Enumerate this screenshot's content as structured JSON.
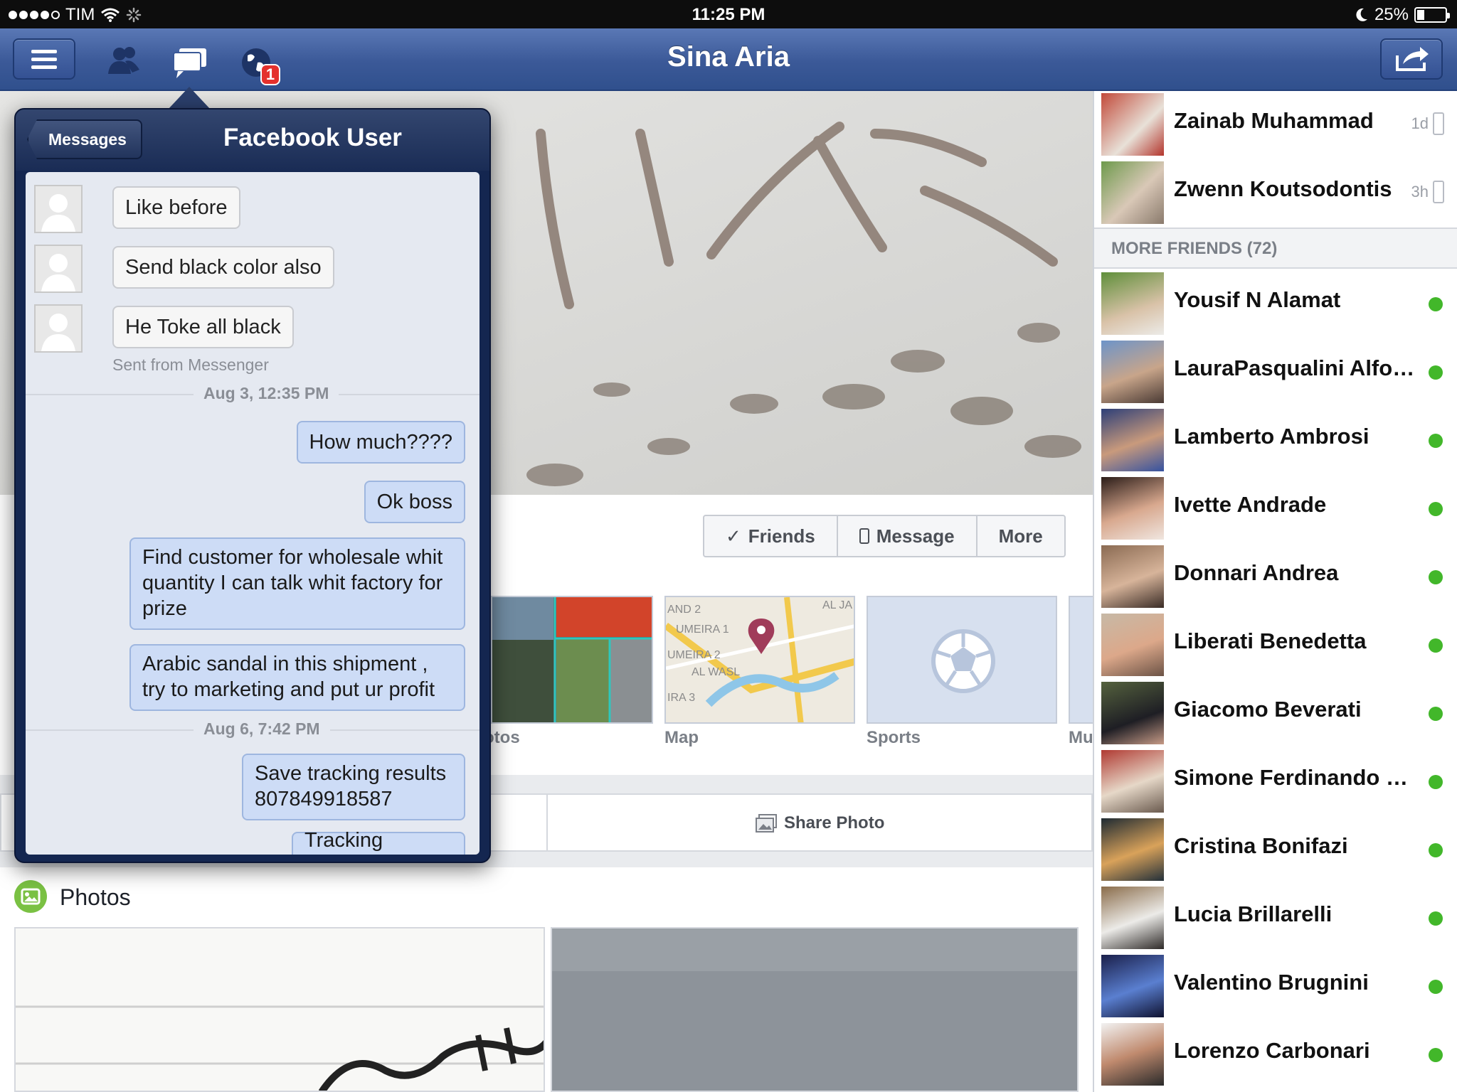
{
  "status_bar": {
    "carrier": "TIM",
    "time": "11:25 PM",
    "battery": "25%",
    "battery_level": 0.25
  },
  "navbar": {
    "title": "Sina Aria",
    "notification_count": "1",
    "icons": [
      "menu-icon",
      "friend-requests-icon",
      "messages-icon",
      "notifications-globe-icon",
      "share-icon"
    ]
  },
  "profile": {
    "buttons": {
      "friends": "Friends",
      "message": "Message",
      "more": "More"
    },
    "tiles": {
      "photos": "otos",
      "map": "Map",
      "sports": "Sports",
      "music": "Mu"
    },
    "map_labels": [
      "AND 2",
      "UMEIRA 1",
      "UMEIRA 2",
      "AL WASL",
      "IRA 3",
      "AL JA"
    ],
    "share_photo": "Share Photo",
    "photos_title": "Photos"
  },
  "messages_popover": {
    "back_label": "Messages",
    "title": "Facebook User",
    "incoming": [
      "Like before",
      "Send black color also",
      "He Toke all black"
    ],
    "sent_from": "Sent from Messenger",
    "date_1": "Aug 3, 12:35 PM",
    "outgoing_1": [
      "How much????",
      "Ok boss",
      "Find customer for wholesale whit quantity I can talk whit factory for prize",
      "Arabic sandal in this shipment , try to marketing and put ur profit"
    ],
    "date_2": "Aug 6, 7:42 PM",
    "outgoing_2": [
      "Save tracking results 807849918587",
      "Tracking number"
    ]
  },
  "friends_sidebar": {
    "recent": [
      {
        "name": "Zainab Muhammad",
        "ago": "1d"
      },
      {
        "name": "Zwenn Koutsodontis",
        "ago": "3h"
      }
    ],
    "more_header": "MORE FRIENDS (72)",
    "online": [
      "Yousif N Alamat",
      "LauraPasqualini Alfonsi",
      "Lamberto Ambrosi",
      "Ivette Andrade",
      "Donnari Andrea",
      "Liberati Benedetta",
      "Giacomo Beverati",
      "Simone Ferdinando Bianchi",
      "Cristina Bonifazi",
      "Lucia Brillarelli",
      "Valentino Brugnini",
      "Lorenzo Carbonari"
    ]
  },
  "colors": {
    "facebook_blue": "#3b5998",
    "online_green": "#42b72a",
    "badge_red": "#e4312d",
    "outgoing_bubble": "#cddcf6"
  }
}
